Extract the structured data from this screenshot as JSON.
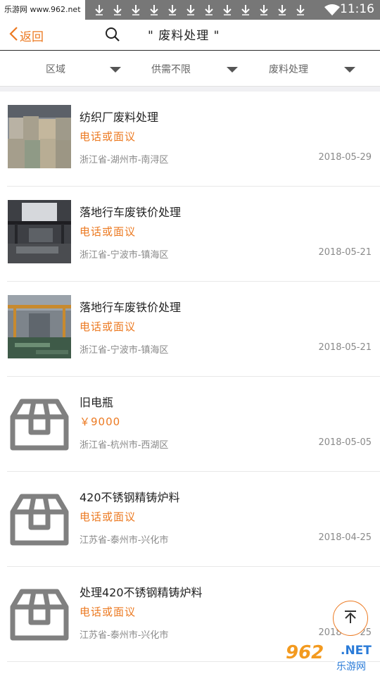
{
  "status_bar": {
    "watermark": "乐游网 www.962.net",
    "time": "11:16",
    "notification_count": 12
  },
  "header": {
    "back_label": "返回",
    "title": "\" 废料处理 \""
  },
  "filters": [
    {
      "label": "区域"
    },
    {
      "label": "供需不限"
    },
    {
      "label": "废料处理"
    }
  ],
  "items": [
    {
      "title": "纺织厂废料处理",
      "price": "电话或面议",
      "location": "浙江省-湖州市-南浔区",
      "date": "2018-05-29",
      "thumb": "fabric-bales-photo"
    },
    {
      "title": "落地行车废铁价处理",
      "price": "电话或面议",
      "location": "浙江省-宁波市-镇海区",
      "date": "2018-05-21",
      "thumb": "workshop-crane-photo"
    },
    {
      "title": "落地行车废铁价处理",
      "price": "电话或面议",
      "location": "浙江省-宁波市-镇海区",
      "date": "2018-05-21",
      "thumb": "scrap-iron-photo"
    },
    {
      "title": "旧电瓶",
      "price": "￥9000",
      "location": "浙江省-杭州市-西湖区",
      "date": "2018-05-05",
      "thumb": "placeholder-box-icon"
    },
    {
      "title": "420不锈钢精铸炉料",
      "price": "电话或面议",
      "location": "江苏省-泰州市-兴化市",
      "date": "2018-04-25",
      "thumb": "placeholder-box-icon"
    },
    {
      "title": "处理420不锈钢精铸炉料",
      "price": "电话或面议",
      "location": "江苏省-泰州市-兴化市",
      "date": "2018-04-25",
      "thumb": "placeholder-box-icon"
    }
  ],
  "watermark_bottom": {
    "big": "962",
    "net": ".NET",
    "small": "乐游网"
  },
  "colors": {
    "accent": "#ec7a22",
    "status_bar": "#777777",
    "text_primary": "#222222",
    "text_secondary": "#8a8a8a"
  }
}
